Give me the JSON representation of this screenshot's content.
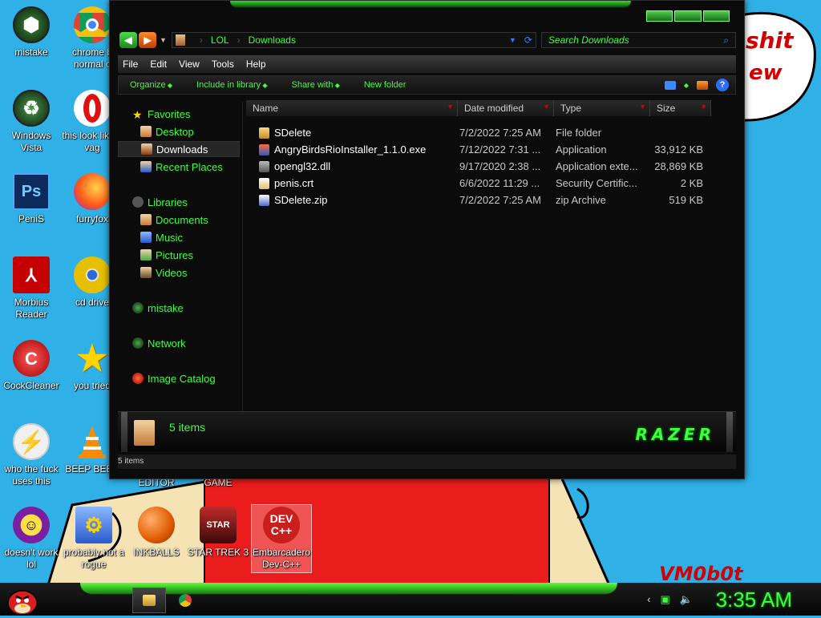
{
  "desktop": {
    "icons": [
      {
        "label": "mistake",
        "icon": "razer-orb-icon",
        "color": "#1a3a1a"
      },
      {
        "label": "chrome b normal c",
        "icon": "chrome-icon",
        "color": "#e8e8e8"
      },
      {
        "label": "Windows Vista",
        "icon": "recycle-bin-icon",
        "color": "#1a3a1a"
      },
      {
        "label": "this look like a vag",
        "icon": "opera-icon",
        "color": "#e01010"
      },
      {
        "label": "PeniS",
        "icon": "photoshop-icon",
        "color": "#0c2a5a"
      },
      {
        "label": "furryfox",
        "icon": "firefox-icon",
        "color": "#ff7a1a"
      },
      {
        "label": "Morbius Reader",
        "icon": "pdf-reader-icon",
        "color": "#c40000"
      },
      {
        "label": "cd drive",
        "icon": "cd-icon",
        "color": "#e6c000"
      },
      {
        "label": "CockCleaner",
        "icon": "ccleaner-icon",
        "color": "#c41a1a"
      },
      {
        "label": "you tried",
        "icon": "star-icon",
        "color": "#ffd400"
      },
      {
        "label": "who the fuck uses this",
        "icon": "flash-icon",
        "color": "#f0f0f0"
      },
      {
        "label": "BEEP BEEP",
        "icon": "vlc-icon",
        "color": "#ff8a00"
      },
      {
        "label": "doesn't work lol",
        "icon": "yahoo-messenger-icon",
        "color": "#7b1fa2"
      },
      {
        "label": "probably not a rogue",
        "icon": "gears-icon",
        "color": "#4a7acc"
      },
      {
        "label": "INKBALLS",
        "icon": "inkball-icon",
        "color": "#f06000"
      },
      {
        "label": "STAR TREK 3",
        "icon": "star-wars-icon",
        "color": "#8a1a1a"
      },
      {
        "label": "Embarcadero Dev-C++",
        "icon": "dev-cpp-icon",
        "color": "#c81e1e"
      }
    ],
    "partial_labels": [
      "EDITOR",
      "GAME"
    ],
    "wall_texts": [
      "shit",
      "ew",
      "VM0b0t"
    ]
  },
  "explorer": {
    "breadcrumb": [
      "LOL",
      "Downloads"
    ],
    "search_placeholder": "Search Downloads",
    "menu": [
      "File",
      "Edit",
      "View",
      "Tools",
      "Help"
    ],
    "commands": [
      "Organize",
      "Include in library",
      "Share with",
      "New folder"
    ],
    "nav": {
      "favorites": "Favorites",
      "favorites_items": [
        "Desktop",
        "Downloads",
        "Recent Places"
      ],
      "libraries": "Libraries",
      "libraries_items": [
        "Documents",
        "Music",
        "Pictures",
        "Videos"
      ],
      "homegroup": "mistake",
      "network": "Network",
      "catalog": "Image Catalog"
    },
    "columns": [
      "Name",
      "Date modified",
      "Type",
      "Size"
    ],
    "files": [
      {
        "name": "SDelete",
        "date": "7/2/2022 7:25 AM",
        "type": "File folder",
        "size": "",
        "icon": "folder-icon",
        "color": "#e8b04a"
      },
      {
        "name": "AngryBirdsRioInstaller_1.1.0.exe",
        "date": "7/12/2022 7:31 ...",
        "type": "Application",
        "size": "33,912 KB",
        "icon": "installer-icon",
        "color": "#4a7acc"
      },
      {
        "name": "opengl32.dll",
        "date": "9/17/2020 2:38 ...",
        "type": "Application exte...",
        "size": "28,869 KB",
        "icon": "dll-icon",
        "color": "#8a8a8a"
      },
      {
        "name": "penis.crt",
        "date": "6/6/2022 11:29 ...",
        "type": "Security Certific...",
        "size": "2 KB",
        "icon": "certificate-icon",
        "color": "#e0c070"
      },
      {
        "name": "SDelete.zip",
        "date": "7/2/2022 7:25 AM",
        "type": "zip Archive",
        "size": "519 KB",
        "icon": "zip-icon",
        "color": "#4a6acc"
      }
    ],
    "details_count": "5 items",
    "brand": "RAZER",
    "status_text": "5 items"
  },
  "taskbar": {
    "clock": "3:35 AM"
  }
}
